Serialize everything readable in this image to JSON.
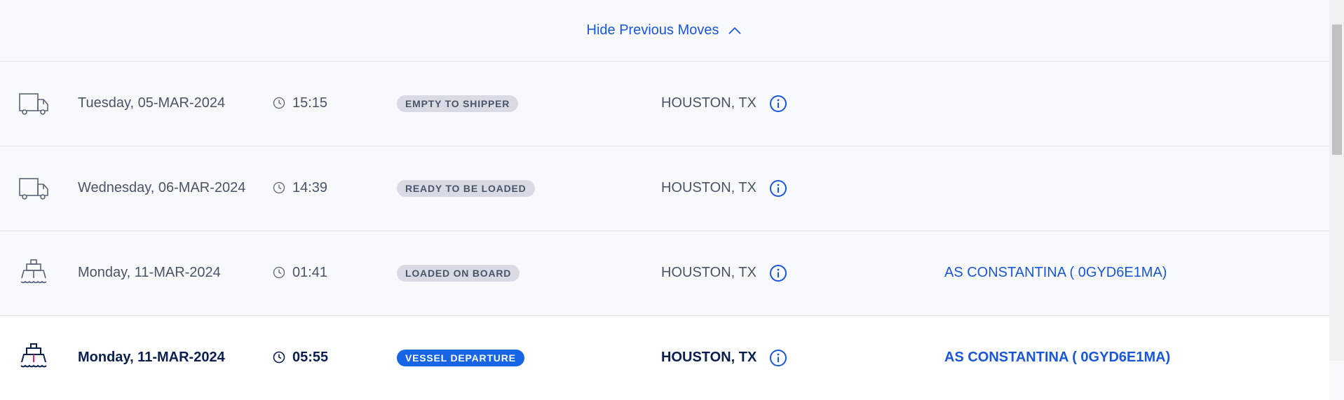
{
  "toggle": {
    "label": "Hide Previous Moves",
    "icon": "chevron-up-icon"
  },
  "events": [
    {
      "icon": "truck-icon",
      "date": "Tuesday, 05-MAR-2024",
      "time": "15:15",
      "status": "EMPTY TO SHIPPER",
      "location": "HOUSTON, TX",
      "vessel": ""
    },
    {
      "icon": "truck-icon",
      "date": "Wednesday, 06-MAR-2024",
      "time": "14:39",
      "status": "READY TO BE LOADED",
      "location": "HOUSTON, TX",
      "vessel": ""
    },
    {
      "icon": "ship-icon",
      "date": "Monday, 11-MAR-2024",
      "time": "01:41",
      "status": "LOADED ON BOARD",
      "location": "HOUSTON, TX",
      "vessel": "AS CONSTANTINA ( 0GYD6E1MA)"
    },
    {
      "icon": "ship-icon",
      "date": "Monday, 11-MAR-2024",
      "time": "05:55",
      "status": "VESSEL DEPARTURE",
      "location": "HOUSTON, TX",
      "vessel": "AS CONSTANTINA ( 0GYD6E1MA)"
    }
  ],
  "colors": {
    "link": "#1a56db",
    "text_muted": "#4a5468",
    "text_current": "#0b1f4f",
    "badge_bg": "#d8dbe3",
    "badge_current_bg": "#1565e6",
    "row_bg": "#f8f9fb",
    "row_current_bg": "#ffffff"
  }
}
